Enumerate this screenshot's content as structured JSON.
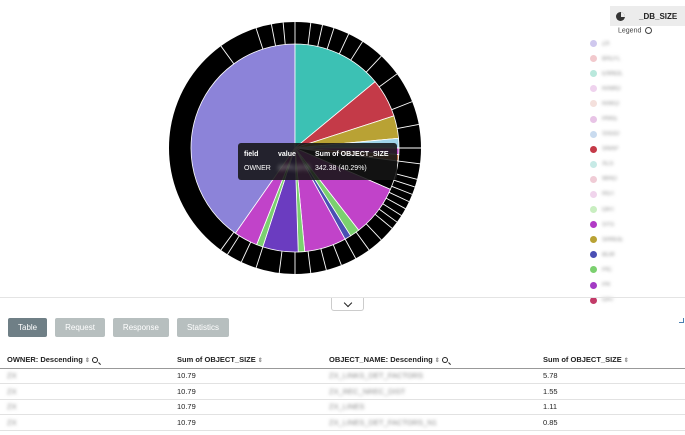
{
  "chart_data": {
    "type": "pie",
    "slices": [
      {
        "value": 40.29,
        "color": "#8c83d9"
      },
      {
        "value": 14.0,
        "color": "#3cc1b4"
      },
      {
        "value": 6.0,
        "color": "#c43a48"
      },
      {
        "value": 3.5,
        "color": "#b9a234"
      },
      {
        "value": 1.5,
        "color": "#9fd5ea"
      },
      {
        "value": 1.0,
        "color": "#c34ec8"
      },
      {
        "value": 1.0,
        "color": "#b46b40"
      },
      {
        "value": 4.5,
        "color": "#000000"
      },
      {
        "value": 8.0,
        "color": "#c143c9"
      },
      {
        "value": 1.5,
        "color": "#7bd06f"
      },
      {
        "value": 1.0,
        "color": "#4a4fb4"
      },
      {
        "value": 6.5,
        "color": "#c143c9"
      },
      {
        "value": 1.0,
        "color": "#7bd06f"
      },
      {
        "value": 5.5,
        "color": "#6b3cc0"
      },
      {
        "value": 1.0,
        "color": "#7bd06f"
      },
      {
        "value": 3.7,
        "color": "#c143c9"
      }
    ]
  },
  "tooltip": {
    "col_field": "field",
    "col_value": "value",
    "col_sum": "Sum of OBJECT_SIZE",
    "field": "OWNER",
    "value": "APPLSYS",
    "sum": "342.38 (40.29%)"
  },
  "legend": {
    "title": "_DB_SIZE",
    "toggle_label": "Legend",
    "items": [
      {
        "label": "ZX",
        "color": "#cfc8ee"
      },
      {
        "label": "BALFL",
        "color": "#f2c9cd"
      },
      {
        "label": "ENNOL",
        "color": "#b9e8dc"
      },
      {
        "label": "RAWO",
        "color": "#efd3ee"
      },
      {
        "label": "RAKO",
        "color": "#f4e0dc"
      },
      {
        "label": "PAKE",
        "color": "#e8c4e6"
      },
      {
        "label": "SSGO",
        "color": "#c9dbef"
      },
      {
        "label": "SNAP",
        "color": "#c43a48"
      },
      {
        "label": "XLS",
        "color": "#c7eae6"
      },
      {
        "label": "WHO",
        "color": "#f0ccd6"
      },
      {
        "label": "RGT",
        "color": "#f0d4ec"
      },
      {
        "label": "OHT",
        "color": "#c9eec1"
      },
      {
        "label": "SYS",
        "color": "#b23bc6"
      },
      {
        "label": "SHNUE",
        "color": "#b9a234"
      },
      {
        "label": "BLM",
        "color": "#4a4fb4"
      },
      {
        "label": "PIC",
        "color": "#7bd06f"
      },
      {
        "label": "PR",
        "color": "#a33bc4"
      },
      {
        "label": "OAT",
        "color": "#c23a68"
      }
    ]
  },
  "tabs": [
    "Table",
    "Request",
    "Response",
    "Statistics"
  ],
  "table": {
    "headers": [
      "OWNER: Descending",
      "Sum of OBJECT_SIZE",
      "OBJECT_NAME: Descending",
      "Sum of OBJECT_SIZE"
    ],
    "rows": [
      [
        "ZX",
        "10.79",
        "ZX_LINKS_DET_FACTORS",
        "5.78"
      ],
      [
        "ZX",
        "10.79",
        "ZX_REC_NREC_DIST",
        "1.55"
      ],
      [
        "ZX",
        "10.79",
        "ZX_LINES",
        "1.11"
      ],
      [
        "ZX",
        "10.79",
        "ZX_LINES_DET_FACTORS_N1",
        "0.85"
      ]
    ]
  }
}
